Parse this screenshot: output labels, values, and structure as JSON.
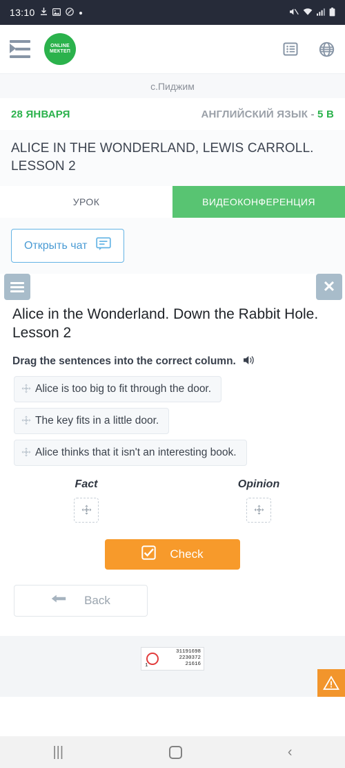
{
  "status_bar": {
    "time": "13:10",
    "left_icons": [
      "download-icon",
      "image-icon",
      "circle-check-icon",
      "dot-icon"
    ],
    "right_icons": [
      "mute-icon",
      "wifi-icon",
      "signal-icon",
      "battery-icon"
    ]
  },
  "app_bar": {
    "menu_icon": "list-arrow-menu-icon",
    "logo_line1": "ONLINE",
    "logo_line2": "МЕКТЕП",
    "logo_color": "#2bb24c",
    "list_icon": "list-icon",
    "globe_icon": "globe-icon"
  },
  "school": {
    "name": "с.Пиджим"
  },
  "meta": {
    "date": "28 ЯНВАРЯ",
    "subject": "АНГЛИЙСКИЙ ЯЗЫК - ",
    "grade": "5 В",
    "date_color": "#2bb24c",
    "grade_color": "#2bb24c"
  },
  "lesson": {
    "title": "ALICE IN THE WONDERLAND, LEWIS CARROLL. LESSON 2"
  },
  "tabs": [
    {
      "label": "УРОК",
      "active": false
    },
    {
      "label": "ВИДЕОКОНФЕРЕНЦИЯ",
      "active": true
    }
  ],
  "chat": {
    "label": "Открыть чат",
    "icon": "chat-bubble-icon",
    "accent": "#63b3e4"
  },
  "exercise": {
    "menu_icon": "hamburger-icon",
    "close_icon": "close-icon",
    "title": "Alice in the Wonderland. Down the Rabbit Hole. Lesson 2",
    "instruction": "Drag the sentences into the correct column.",
    "speaker_icon": "speaker-icon",
    "sentences": [
      "Alice is too big to fit through the door.",
      "The key fits in a little door.",
      "Alice thinks that it isn't an interesting book."
    ],
    "move_icon": "move-arrows-icon",
    "columns": [
      {
        "title": "Fact",
        "drop_icon": "drop-target-icon"
      },
      {
        "title": "Opinion",
        "drop_icon": "drop-target-icon"
      }
    ],
    "check_button": {
      "label": "Check",
      "icon": "checkbox-icon",
      "color": "#f79a2b"
    },
    "back_button": {
      "label": "Back",
      "icon": "arrow-left-icon"
    }
  },
  "counter": {
    "value1": "31191698",
    "value2": "2230372",
    "value3": "21616",
    "corner": "1",
    "ring_color": "#e23b3b"
  },
  "warning": {
    "icon": "warning-triangle-icon",
    "color": "#f2952c"
  },
  "nav_bar": {
    "recents_icon": "recents-icon",
    "recents_glyph": "|||",
    "home_icon": "home-icon",
    "back_icon": "back-chevron-icon",
    "back_glyph": "‹"
  }
}
